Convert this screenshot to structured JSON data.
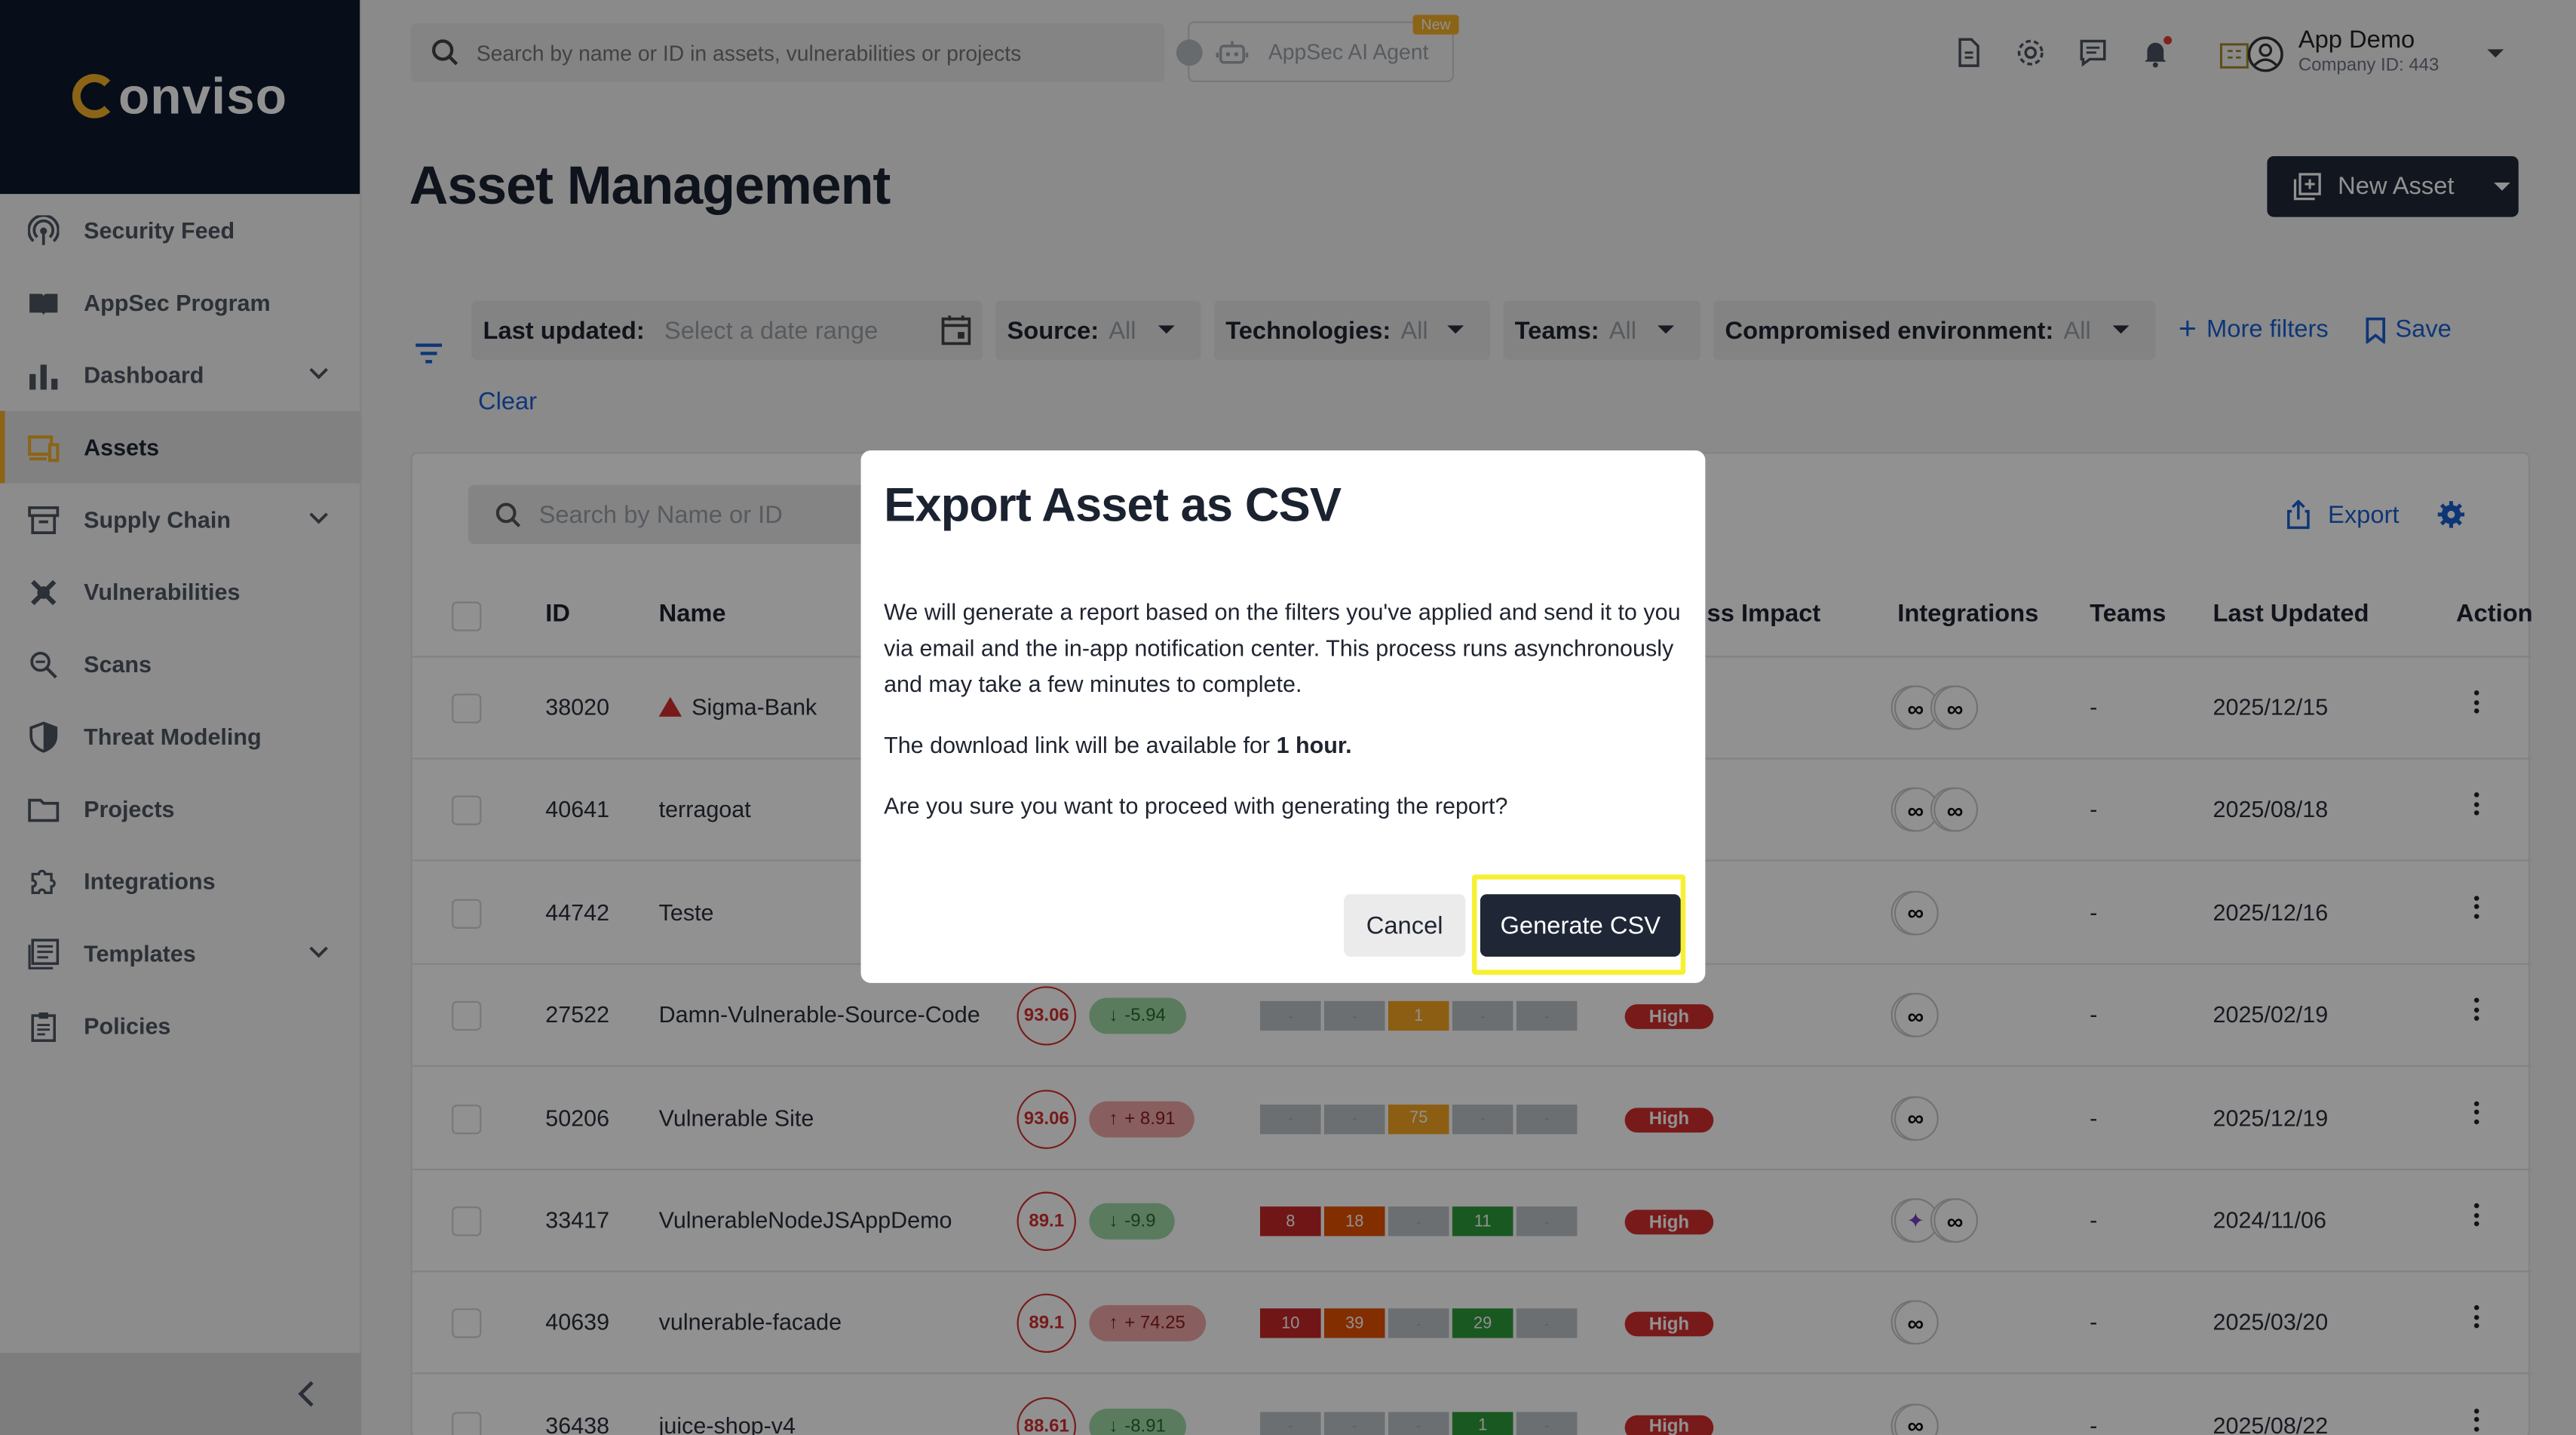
{
  "brand": {
    "logo_text": "onviso",
    "accent_color": "#f5b027",
    "primary_dark": "#1f2737"
  },
  "topbar": {
    "search_placeholder": "Search by name or ID in assets, vulnerabilities or projects",
    "ai_agent_label": "AppSec AI Agent",
    "new_badge": "New",
    "user_name": "App Demo",
    "company_id": "Company ID: 443",
    "icons": [
      "document-icon",
      "gear-icon",
      "chat-icon",
      "bell-icon"
    ]
  },
  "sidebar": {
    "items": [
      {
        "label": "Security Feed",
        "icon": "broadcast-icon"
      },
      {
        "label": "AppSec Program",
        "icon": "book-icon"
      },
      {
        "label": "Dashboard",
        "icon": "bar-chart-icon",
        "expandable": true
      },
      {
        "label": "Assets",
        "icon": "devices-icon",
        "active": true
      },
      {
        "label": "Supply Chain",
        "icon": "archive-icon",
        "expandable": true
      },
      {
        "label": "Vulnerabilities",
        "icon": "bug-icon"
      },
      {
        "label": "Scans",
        "icon": "scan-search-icon"
      },
      {
        "label": "Threat Modeling",
        "icon": "shield-icon"
      },
      {
        "label": "Projects",
        "icon": "folder-icon"
      },
      {
        "label": "Integrations",
        "icon": "puzzle-icon"
      },
      {
        "label": "Templates",
        "icon": "template-icon",
        "expandable": true
      },
      {
        "label": "Policies",
        "icon": "clipboard-icon"
      }
    ]
  },
  "page": {
    "title": "Asset Management",
    "new_asset_label": "New Asset"
  },
  "filters": {
    "last_updated_label": "Last updated:",
    "last_updated_placeholder": "Select a date range",
    "source_label": "Source:",
    "source_value": "All",
    "technologies_label": "Technologies:",
    "technologies_value": "All",
    "teams_label": "Teams:",
    "teams_value": "All",
    "compromised_label": "Compromised environment:",
    "compromised_value": "All",
    "more_filters": "More filters",
    "save": "Save",
    "clear": "Clear"
  },
  "table": {
    "search_placeholder": "Search by Name or ID",
    "export_label": "Export",
    "headers": {
      "id": "ID",
      "name": "Name",
      "impact": "ss Impact",
      "integrations": "Integrations",
      "teams": "Teams",
      "last_updated": "Last Updated",
      "action": "Action"
    },
    "rows": [
      {
        "id": "38020",
        "name": "Sigma-Bank",
        "warning": true,
        "teams": "-",
        "updated": "2025/12/15",
        "integrations": 2
      },
      {
        "id": "40641",
        "name": "terragoat",
        "teams": "-",
        "updated": "2025/08/18",
        "integrations": 2
      },
      {
        "id": "44742",
        "name": "Teste",
        "teams": "-",
        "updated": "2025/12/16",
        "integrations": 1
      },
      {
        "id": "27522",
        "name": "Damn-Vulnerable-Source-Code",
        "score": "93.06",
        "delta": "-5.94",
        "dir": "down",
        "sev": [
          "-",
          "-",
          "1",
          "-",
          "-"
        ],
        "impact": "High",
        "teams": "-",
        "updated": "2025/02/19",
        "integrations": 1
      },
      {
        "id": "50206",
        "name": "Vulnerable Site",
        "score": "93.06",
        "delta": "+ 8.91",
        "dir": "up",
        "sev": [
          "-",
          "-",
          "75",
          "-",
          "-"
        ],
        "impact": "High",
        "teams": "-",
        "updated": "2025/12/19",
        "integrations": 1
      },
      {
        "id": "33417",
        "name": "VulnerableNodeJSAppDemo",
        "score": "89.1",
        "delta": "-9.9",
        "dir": "down",
        "sev": [
          "8",
          "18",
          "-",
          "11",
          "-"
        ],
        "impact": "High",
        "teams": "-",
        "updated": "2024/11/06",
        "integrations": 2
      },
      {
        "id": "40639",
        "name": "vulnerable-facade",
        "score": "89.1",
        "delta": "+ 74.25",
        "dir": "up",
        "sev": [
          "10",
          "39",
          "-",
          "29",
          "-"
        ],
        "impact": "High",
        "teams": "-",
        "updated": "2025/03/20",
        "integrations": 1
      },
      {
        "id": "36438",
        "name": "juice-shop-v4",
        "score": "88.61",
        "delta": "-8.91",
        "dir": "down",
        "sev": [
          "-",
          "-",
          "-",
          "1",
          "-"
        ],
        "impact": "High",
        "teams": "-",
        "updated": "2025/08/22",
        "integrations": 1
      }
    ]
  },
  "modal": {
    "title": "Export Asset as CSV",
    "body1": "We will generate a report based on the filters you've applied and send it to you via email and the in-app notification center. This process runs asynchronously and may take a few minutes to complete.",
    "body2_prefix": "The download link will be available for ",
    "body2_bold": "1 hour.",
    "body3": "Are you sure you want to proceed with generating the report?",
    "cancel": "Cancel",
    "generate": "Generate CSV"
  }
}
